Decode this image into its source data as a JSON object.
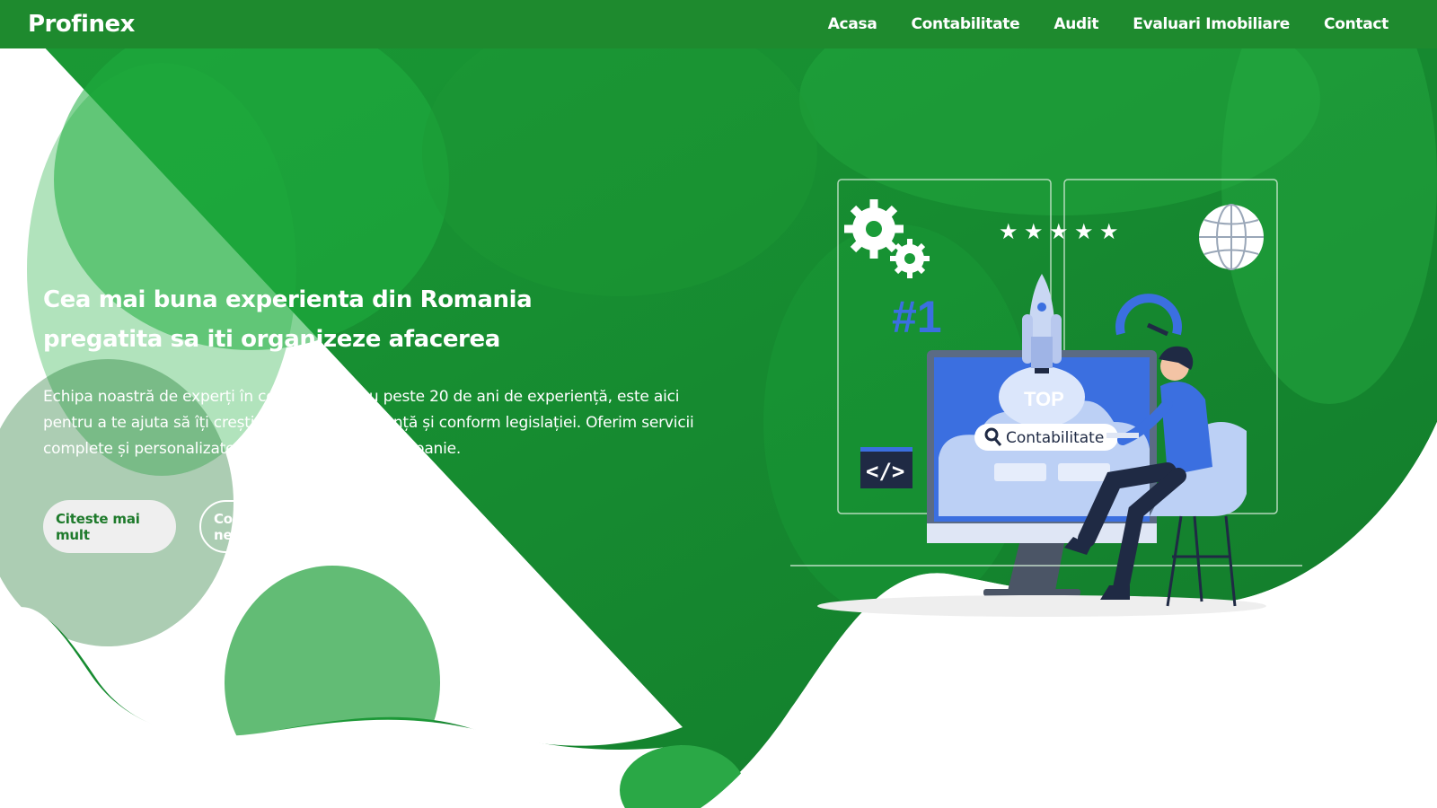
{
  "nav": {
    "brand": "Profinex",
    "links": [
      {
        "label": "Acasa"
      },
      {
        "label": "Contabilitate"
      },
      {
        "label": "Audit"
      },
      {
        "label": "Evaluari Imobiliare"
      },
      {
        "label": "Contact"
      }
    ]
  },
  "hero": {
    "title_line1": "Cea mai buna experienta din Romania",
    "title_line2": "pregatita sa iti organizeze afacerea",
    "description": "Echipa noastră de experți în contabilitate, cu peste 20 de ani de experiență, este aici pentru a te ajuta să îți crești afacerea în siguranță și conform legislației. Oferim servicii complete și personalizate pentru orice tip de companie.",
    "primary_button": "Citeste mai mult",
    "secondary_button": "Contacteaza-ne"
  },
  "illustration": {
    "rank_label": "#1",
    "code_label": "</>",
    "top_label": "TOP",
    "search_label": "Contabilitate",
    "rating_stars": 5
  },
  "colors": {
    "nav_bg": "#1e8a2e",
    "hero_green": "#19912f",
    "accent_blue": "#3b6fe0",
    "button_text": "#1e7a2b"
  }
}
